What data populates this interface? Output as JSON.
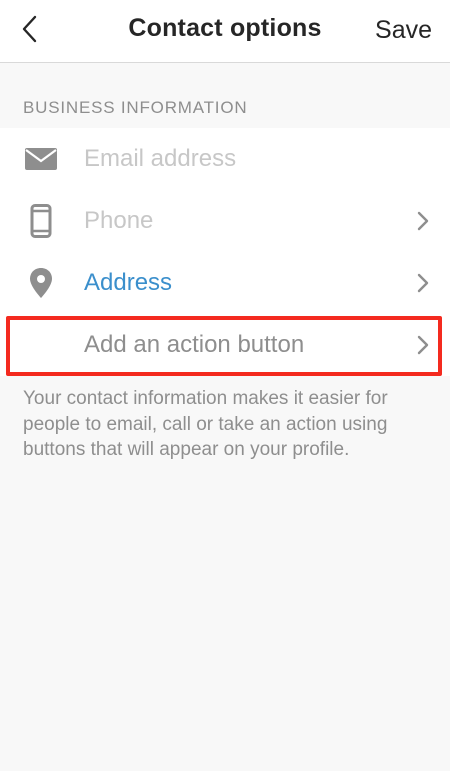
{
  "header": {
    "title": "Contact options",
    "save_label": "Save",
    "back_icon": "chevron-left-icon"
  },
  "section": {
    "header": "BUSINESS INFORMATION"
  },
  "rows": [
    {
      "label": "Email address",
      "icon": "envelope-icon",
      "has_chevron": false
    },
    {
      "label": "Phone",
      "icon": "phone-icon",
      "has_chevron": true
    },
    {
      "label": "Address",
      "icon": "location-pin-icon",
      "has_chevron": true
    },
    {
      "label": "Add an action button",
      "icon": "",
      "has_chevron": true
    }
  ],
  "help_text": "Your contact information makes it easier for people to email, call or take an action using buttons that will appear on your profile.",
  "colors": {
    "accent": "#3b8fcc",
    "highlight": "#f42a1f",
    "placeholder": "#c7c7c7",
    "muted": "#8e8e8e"
  }
}
